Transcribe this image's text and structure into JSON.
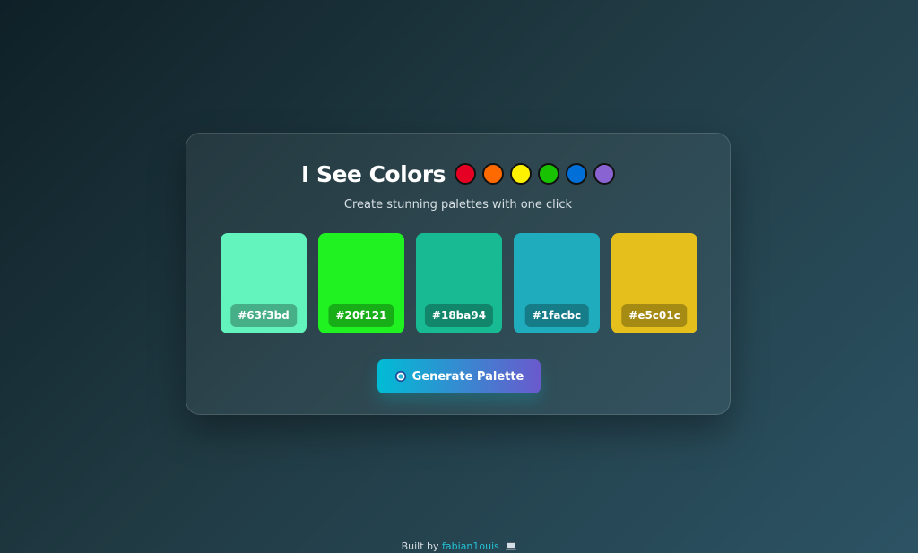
{
  "app": {
    "title": "I See Colors",
    "subtitle": "Create stunning palettes with one click"
  },
  "header": {
    "title_dots": [
      {
        "color": "#e60023"
      },
      {
        "color": "#ff6a00"
      },
      {
        "color": "#fff200"
      },
      {
        "color": "#19c200"
      },
      {
        "color": "#0070d8"
      },
      {
        "color": "#8a63d2"
      }
    ]
  },
  "palette": [
    {
      "hex": "#63f3bd",
      "label": "#63f3bd"
    },
    {
      "hex": "#20f121",
      "label": "#20f121"
    },
    {
      "hex": "#18ba94",
      "label": "#18ba94"
    },
    {
      "hex": "#1facbc",
      "label": "#1facbc"
    },
    {
      "hex": "#e5c01c",
      "label": "#e5c01c"
    }
  ],
  "actions": {
    "generate_label": "Generate Palette",
    "generate_icon": "palette-icon"
  },
  "footer": {
    "prefix": "Built by",
    "author": "fabian1ouis",
    "icon": "laptop-icon"
  }
}
